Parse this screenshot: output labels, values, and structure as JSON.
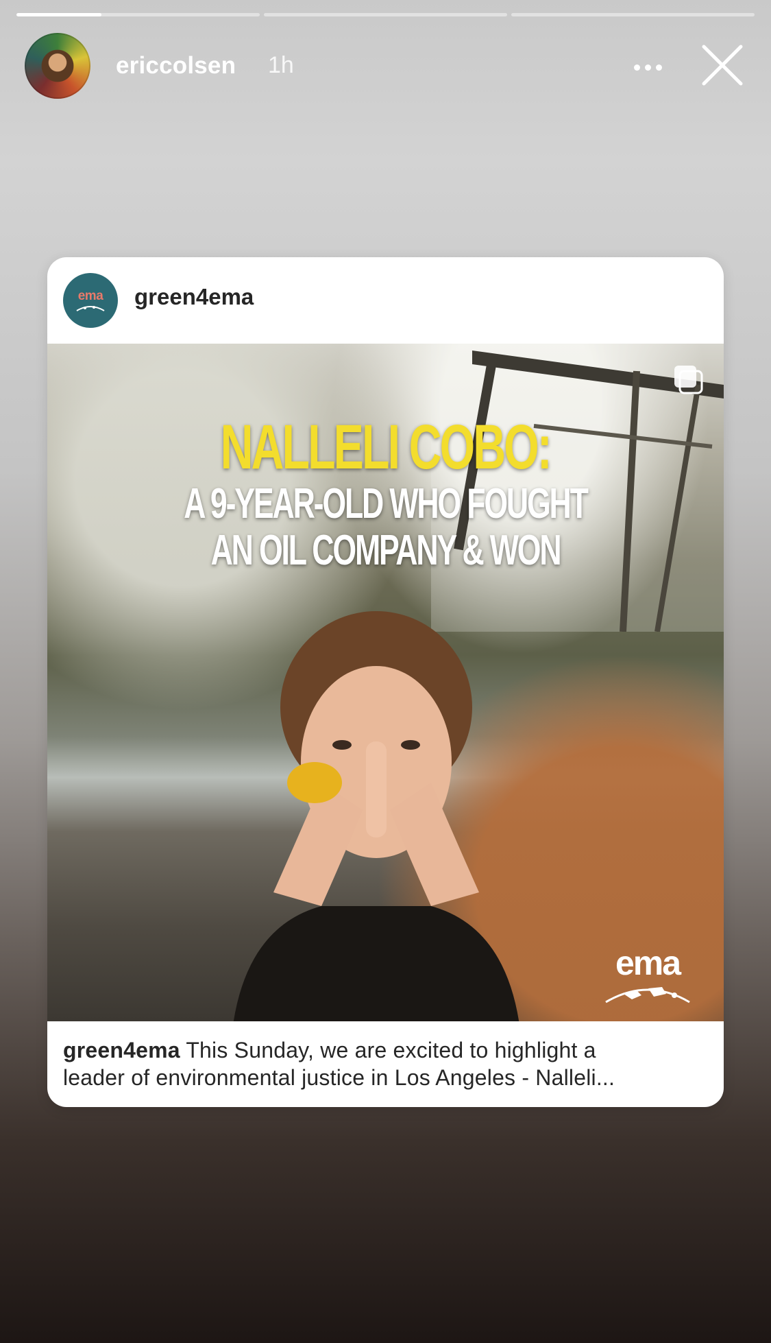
{
  "story": {
    "progress": [
      0.35,
      0,
      0
    ],
    "username": "ericcolsen",
    "time": "1h"
  },
  "post": {
    "username": "green4ema",
    "avatar_logo_text": "ema",
    "headline_name": "NALLELI COBO:",
    "headline_line1": "A 9-YEAR-OLD WHO FOUGHT",
    "headline_line2": "AN OIL COMPANY & WON",
    "brand_logo_text": "ema",
    "caption_user": "green4ema",
    "caption_line1": "This Sunday, we are excited to highlight a",
    "caption_line2": "leader of environmental justice in Los Angeles - Nalleli..."
  },
  "colors": {
    "headline_name": "#f3dd2d",
    "card_avatar_bg": "#2c6a74"
  },
  "icons": [
    "more-icon",
    "close-icon",
    "multiple-images-icon"
  ]
}
